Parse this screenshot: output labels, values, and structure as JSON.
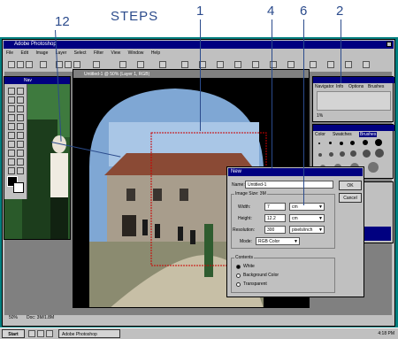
{
  "callouts": {
    "steps": "STEPS",
    "n12": "12",
    "n1": "1",
    "n4": "4",
    "n6": "6",
    "n2": "2"
  },
  "app": {
    "title": "Adobe Photoshop",
    "menu": [
      "File",
      "Edit",
      "Image",
      "Layer",
      "Select",
      "Filter",
      "View",
      "Window",
      "Help"
    ]
  },
  "document": {
    "title": "Untitled-1 @ 50% (Layer 1, RGB)"
  },
  "toolbox": {
    "title": "Nav"
  },
  "navigator": {
    "tabs": [
      "Navigator",
      "Info",
      "Options",
      "Brushes"
    ],
    "zoom_label": "1%"
  },
  "brushes": {
    "tabs": [
      "Color",
      "Swatches",
      "Brushes"
    ]
  },
  "dialog": {
    "title": "New",
    "name_label": "Name:",
    "name_value": "Untitled-1",
    "image_size_label": "Image Size: 3M",
    "width_label": "Width:",
    "width_value": "7",
    "width_unit": "cm",
    "height_label": "Height:",
    "height_value": "12.2",
    "height_unit": "cm",
    "resolution_label": "Resolution:",
    "resolution_value": "300",
    "resolution_unit": "pixels/inch",
    "mode_label": "Mode:",
    "mode_value": "RGB Color",
    "contents_label": "Contents",
    "contents_options": [
      "White",
      "Background Color",
      "Transparent"
    ],
    "ok_label": "OK",
    "cancel_label": "Cancel"
  },
  "status": {
    "zoom": "50%",
    "doc": "Doc: 3M/1.8M"
  },
  "taskbar": {
    "start_label": "Start",
    "app_label": "Adobe Photoshop",
    "clock": "4:18 PM"
  },
  "colors": {
    "desktop": "#008080",
    "titlebar": "#000080",
    "callout": "#2b4b8c",
    "dialog": "#c0c0c0"
  }
}
